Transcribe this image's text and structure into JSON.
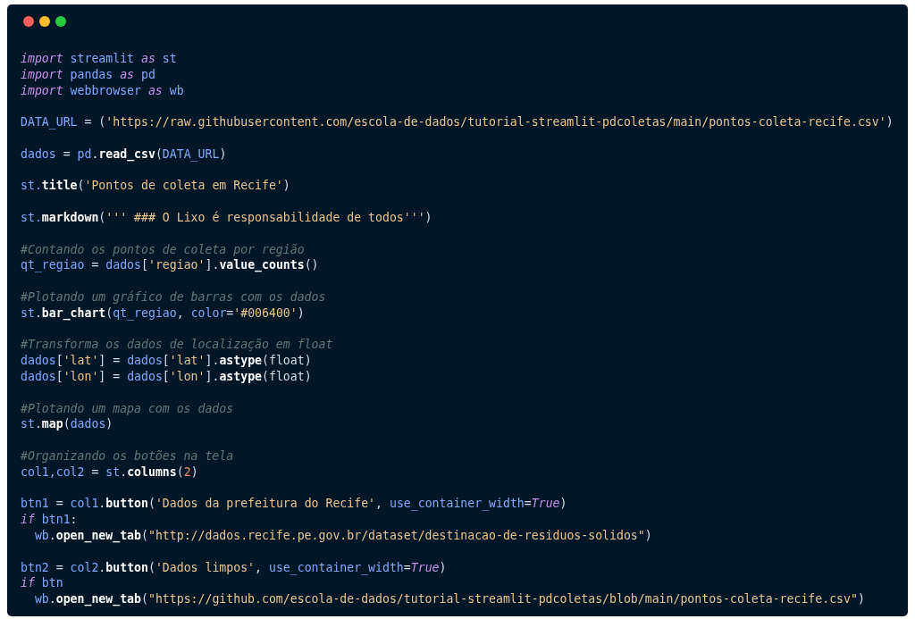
{
  "window": {
    "controls": [
      {
        "color": "#ff5f56"
      },
      {
        "color": "#ffbd2e"
      },
      {
        "color": "#27c93f"
      }
    ]
  },
  "code_blocks": [
    {
      "lines": [
        {
          "tokens": [
            {
              "kind": "keyword",
              "text": "import"
            },
            {
              "kind": "name",
              "text": " streamlit "
            },
            {
              "kind": "keyword",
              "text": "as"
            },
            {
              "kind": "name",
              "text": " st"
            }
          ]
        },
        {
          "tokens": [
            {
              "kind": "keyword",
              "text": "import"
            },
            {
              "kind": "name",
              "text": " pandas "
            },
            {
              "kind": "keyword",
              "text": "as"
            },
            {
              "kind": "name",
              "text": " pd"
            }
          ]
        },
        {
          "tokens": [
            {
              "kind": "keyword",
              "text": "import"
            },
            {
              "kind": "name",
              "text": " webbrowser "
            },
            {
              "kind": "keyword",
              "text": "as"
            },
            {
              "kind": "name",
              "text": " wb"
            }
          ]
        }
      ]
    },
    {
      "lines": [
        {
          "tokens": [
            {
              "kind": "name",
              "text": "DATA_URL"
            },
            {
              "kind": "punct",
              "text": " = ("
            },
            {
              "kind": "string",
              "text": "'https://raw.githubusercontent.com/escola-de-dados/tutorial-streamlit-pdcoletas/main/pontos-coleta-recife.csv'"
            },
            {
              "kind": "punct",
              "text": ")"
            }
          ]
        }
      ]
    },
    {
      "lines": [
        {
          "tokens": [
            {
              "kind": "name",
              "text": "dados"
            },
            {
              "kind": "punct",
              "text": " = "
            },
            {
              "kind": "name",
              "text": "pd"
            },
            {
              "kind": "punct",
              "text": "."
            },
            {
              "kind": "function",
              "text": "read_csv"
            },
            {
              "kind": "punct",
              "text": "("
            },
            {
              "kind": "name",
              "text": "DATA_URL"
            },
            {
              "kind": "punct",
              "text": ")"
            }
          ]
        }
      ]
    },
    {
      "lines": [
        {
          "tokens": [
            {
              "kind": "name",
              "text": "st."
            },
            {
              "kind": "function",
              "text": "title"
            },
            {
              "kind": "punct",
              "text": "("
            },
            {
              "kind": "string",
              "text": "'Pontos de coleta em Recife'"
            },
            {
              "kind": "punct",
              "text": ")"
            }
          ]
        }
      ]
    },
    {
      "lines": [
        {
          "tokens": [
            {
              "kind": "name",
              "text": "st."
            },
            {
              "kind": "function",
              "text": "markdown"
            },
            {
              "kind": "punct",
              "text": "("
            },
            {
              "kind": "string",
              "text": "''' ### O Lixo é responsabilidade de todos'''"
            },
            {
              "kind": "punct",
              "text": ")"
            }
          ]
        }
      ]
    },
    {
      "lines": [
        {
          "tokens": [
            {
              "kind": "comment",
              "text": "#Contando os pontos de coleta por região"
            }
          ]
        },
        {
          "tokens": [
            {
              "kind": "name",
              "text": "qt_regiao"
            },
            {
              "kind": "punct",
              "text": " = "
            },
            {
              "kind": "name",
              "text": "dados"
            },
            {
              "kind": "punct",
              "text": "["
            },
            {
              "kind": "string",
              "text": "'regiao'"
            },
            {
              "kind": "punct",
              "text": "]."
            },
            {
              "kind": "function",
              "text": "value_counts"
            },
            {
              "kind": "punct",
              "text": "()"
            }
          ]
        }
      ]
    },
    {
      "lines": [
        {
          "tokens": [
            {
              "kind": "comment",
              "text": "#Plotando um gráfico de barras com os dados"
            }
          ]
        },
        {
          "tokens": [
            {
              "kind": "name",
              "text": "st"
            },
            {
              "kind": "punct",
              "text": "."
            },
            {
              "kind": "function",
              "text": "bar_chart"
            },
            {
              "kind": "punct",
              "text": "("
            },
            {
              "kind": "name",
              "text": "qt_regiao"
            },
            {
              "kind": "punct",
              "text": ", "
            },
            {
              "kind": "name",
              "text": "color"
            },
            {
              "kind": "punct",
              "text": "="
            },
            {
              "kind": "string",
              "text": "'#006400'"
            },
            {
              "kind": "punct",
              "text": ")"
            }
          ]
        }
      ]
    },
    {
      "lines": [
        {
          "tokens": [
            {
              "kind": "comment",
              "text": "#Transforma os dados de localização em float"
            }
          ]
        },
        {
          "tokens": [
            {
              "kind": "name",
              "text": "dados"
            },
            {
              "kind": "punct",
              "text": "["
            },
            {
              "kind": "string",
              "text": "'lat'"
            },
            {
              "kind": "punct",
              "text": "] = "
            },
            {
              "kind": "name",
              "text": "dados"
            },
            {
              "kind": "punct",
              "text": "["
            },
            {
              "kind": "string",
              "text": "'lat'"
            },
            {
              "kind": "punct",
              "text": "]."
            },
            {
              "kind": "function",
              "text": "astype"
            },
            {
              "kind": "punct",
              "text": "(float)"
            }
          ]
        },
        {
          "tokens": [
            {
              "kind": "name",
              "text": "dados"
            },
            {
              "kind": "punct",
              "text": "["
            },
            {
              "kind": "string",
              "text": "'lon'"
            },
            {
              "kind": "punct",
              "text": "] = "
            },
            {
              "kind": "name",
              "text": "dados"
            },
            {
              "kind": "punct",
              "text": "["
            },
            {
              "kind": "string",
              "text": "'lon'"
            },
            {
              "kind": "punct",
              "text": "]."
            },
            {
              "kind": "function",
              "text": "astype"
            },
            {
              "kind": "punct",
              "text": "(float)"
            }
          ]
        }
      ]
    },
    {
      "lines": [
        {
          "tokens": [
            {
              "kind": "comment",
              "text": "#Plotando um mapa com os dados"
            }
          ]
        },
        {
          "tokens": [
            {
              "kind": "name",
              "text": "st"
            },
            {
              "kind": "punct",
              "text": "."
            },
            {
              "kind": "function",
              "text": "map"
            },
            {
              "kind": "punct",
              "text": "("
            },
            {
              "kind": "name",
              "text": "dados"
            },
            {
              "kind": "punct",
              "text": ")"
            }
          ]
        }
      ]
    },
    {
      "lines": [
        {
          "tokens": [
            {
              "kind": "comment",
              "text": "#Organizando os botões na tela"
            }
          ]
        },
        {
          "tokens": [
            {
              "kind": "name",
              "text": "col1,col2"
            },
            {
              "kind": "punct",
              "text": " = "
            },
            {
              "kind": "name",
              "text": "st"
            },
            {
              "kind": "punct",
              "text": "."
            },
            {
              "kind": "function",
              "text": "columns"
            },
            {
              "kind": "punct",
              "text": "("
            },
            {
              "kind": "number",
              "text": "2"
            },
            {
              "kind": "punct",
              "text": ")"
            }
          ]
        }
      ]
    },
    {
      "lines": [
        {
          "tokens": [
            {
              "kind": "name",
              "text": "btn1"
            },
            {
              "kind": "punct",
              "text": " = "
            },
            {
              "kind": "name",
              "text": "col1"
            },
            {
              "kind": "punct",
              "text": "."
            },
            {
              "kind": "function",
              "text": "button"
            },
            {
              "kind": "punct",
              "text": "("
            },
            {
              "kind": "string",
              "text": "'Dados da prefeitura do Recife'"
            },
            {
              "kind": "punct",
              "text": ", "
            },
            {
              "kind": "name",
              "text": "use_container_width"
            },
            {
              "kind": "punct",
              "text": "="
            },
            {
              "kind": "constant",
              "text": "True"
            },
            {
              "kind": "punct",
              "text": ")"
            }
          ]
        },
        {
          "tokens": [
            {
              "kind": "keyword",
              "text": "if"
            },
            {
              "kind": "name",
              "text": " btn1"
            },
            {
              "kind": "punct",
              "text": ":"
            }
          ]
        },
        {
          "tokens": [
            {
              "kind": "name",
              "text": "  wb"
            },
            {
              "kind": "punct",
              "text": "."
            },
            {
              "kind": "function",
              "text": "open_new_tab"
            },
            {
              "kind": "punct",
              "text": "("
            },
            {
              "kind": "string",
              "text": "\"http://dados.recife.pe.gov.br/dataset/destinacao-de-residuos-solidos\""
            },
            {
              "kind": "punct",
              "text": ")"
            }
          ]
        }
      ]
    },
    {
      "lines": [
        {
          "tokens": [
            {
              "kind": "name",
              "text": "btn2"
            },
            {
              "kind": "punct",
              "text": " = "
            },
            {
              "kind": "name",
              "text": "col2"
            },
            {
              "kind": "punct",
              "text": "."
            },
            {
              "kind": "function",
              "text": "button"
            },
            {
              "kind": "punct",
              "text": "("
            },
            {
              "kind": "string",
              "text": "'Dados limpos'"
            },
            {
              "kind": "punct",
              "text": ", "
            },
            {
              "kind": "name",
              "text": "use_container_width"
            },
            {
              "kind": "punct",
              "text": "="
            },
            {
              "kind": "constant",
              "text": "True"
            },
            {
              "kind": "punct",
              "text": ")"
            }
          ]
        },
        {
          "tokens": [
            {
              "kind": "keyword",
              "text": "if"
            },
            {
              "kind": "name",
              "text": " btn"
            }
          ]
        },
        {
          "tokens": [
            {
              "kind": "name",
              "text": "  wb"
            },
            {
              "kind": "punct",
              "text": "."
            },
            {
              "kind": "function",
              "text": "open_new_tab"
            },
            {
              "kind": "punct",
              "text": "("
            },
            {
              "kind": "string",
              "text": "\"https://github.com/escola-de-dados/tutorial-streamlit-pdcoletas/blob/main/pontos-coleta-recife.csv\""
            },
            {
              "kind": "punct",
              "text": ")"
            }
          ]
        }
      ]
    }
  ]
}
